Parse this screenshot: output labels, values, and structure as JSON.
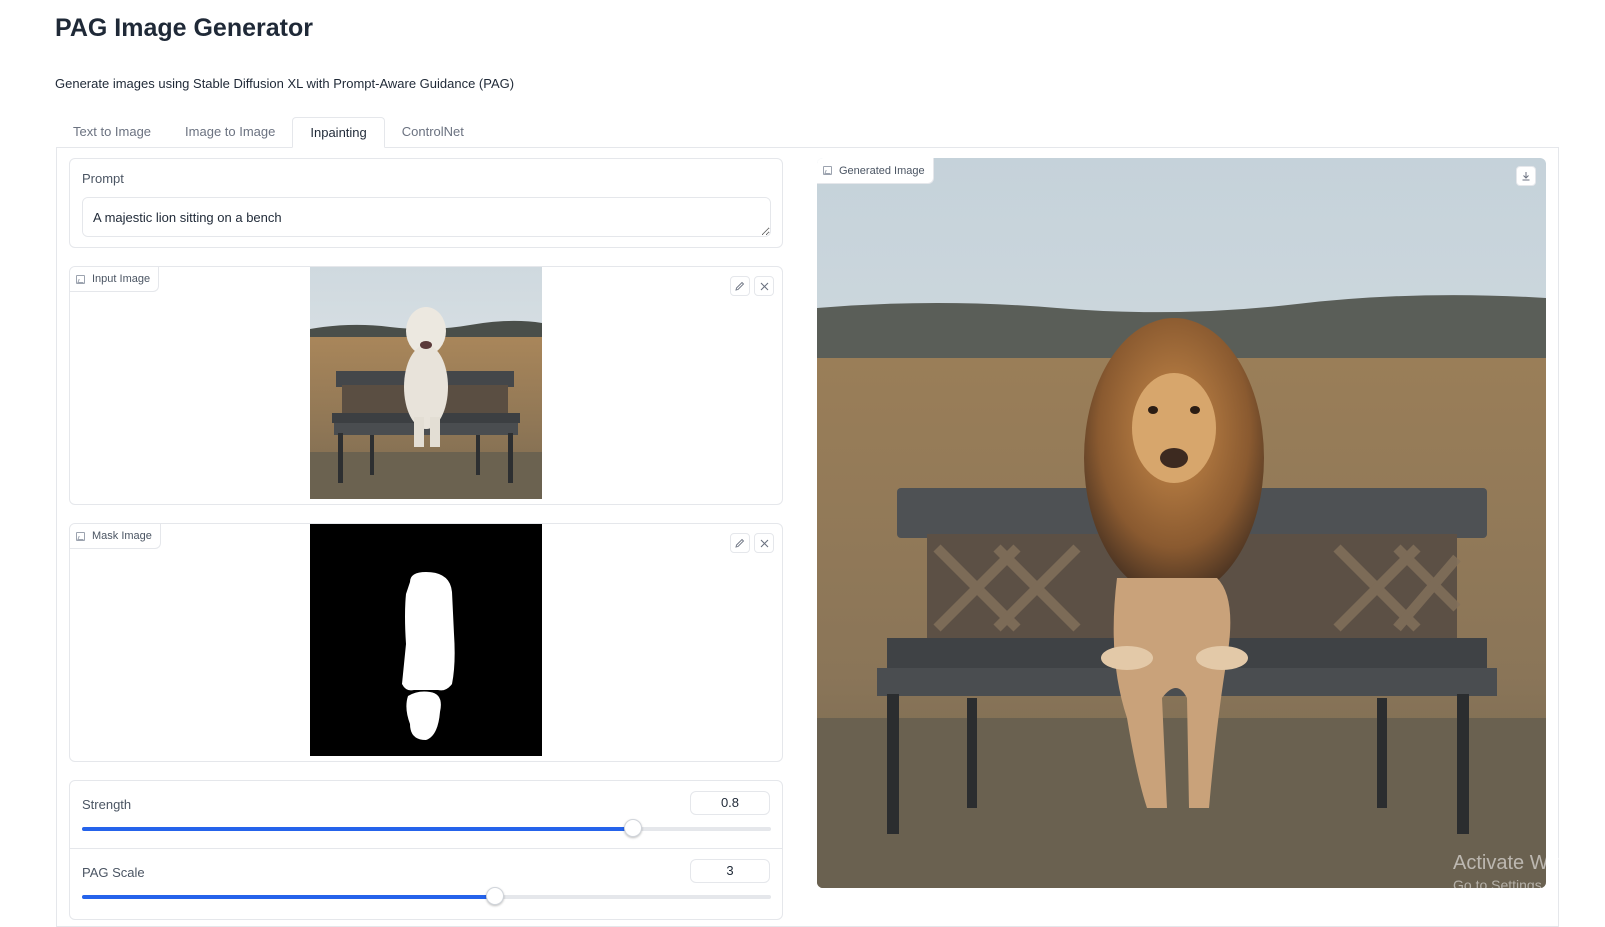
{
  "header": {
    "title": "PAG Image Generator",
    "subtitle": "Generate images using Stable Diffusion XL with Prompt-Aware Guidance (PAG)"
  },
  "tabs": [
    {
      "label": "Text to Image",
      "active": false
    },
    {
      "label": "Image to Image",
      "active": false
    },
    {
      "label": "Inpainting",
      "active": true
    },
    {
      "label": "ControlNet",
      "active": false
    }
  ],
  "prompt": {
    "label": "Prompt",
    "value": "A majestic lion sitting on a bench"
  },
  "input_image": {
    "label": "Input Image"
  },
  "mask_image": {
    "label": "Mask Image"
  },
  "strength": {
    "label": "Strength",
    "value": "0.8",
    "fraction": 0.8
  },
  "pag_scale": {
    "label": "PAG Scale",
    "value": "3",
    "fraction": 0.6
  },
  "output": {
    "label": "Generated Image"
  },
  "watermark": {
    "line1": "Activate Windows",
    "line2": "Go to Settings to activate Windows."
  },
  "colors": {
    "accent": "#2563eb",
    "border": "#e5e7eb"
  }
}
